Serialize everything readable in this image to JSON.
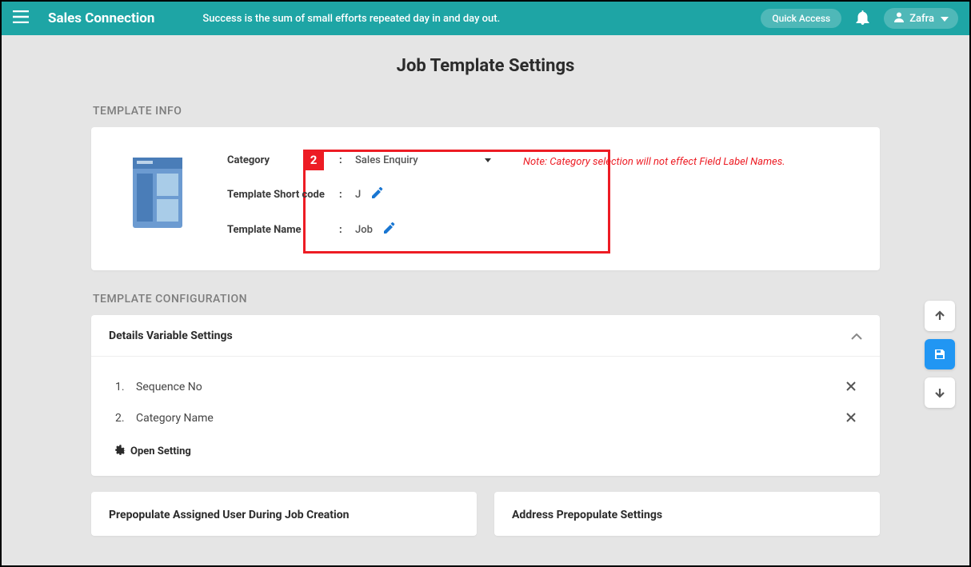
{
  "header": {
    "brand": "Sales Connection",
    "tagline": "Success is the sum of small efforts repeated day in and day out.",
    "quick_access": "Quick Access",
    "user_name": "Zafra"
  },
  "page_title": "Job Template Settings",
  "sections": {
    "template_info": "TEMPLATE INFO",
    "template_config": "TEMPLATE CONFIGURATION"
  },
  "annotation": {
    "badge": "2"
  },
  "template_info": {
    "category_label": "Category",
    "category_value": "Sales Enquiry",
    "shortcode_label": "Template Short code",
    "shortcode_value": "J",
    "name_label": "Template Name",
    "name_value": "Job",
    "note": "Note: Category selection will not effect Field Label Names."
  },
  "accordion": {
    "title": "Details Variable Settings",
    "items": [
      {
        "num": "1.",
        "label": "Sequence No"
      },
      {
        "num": "2.",
        "label": "Category Name"
      }
    ],
    "open_setting": "Open Setting"
  },
  "lower_cards": {
    "left": "Prepopulate Assigned User During Job Creation",
    "right": "Address Prepopulate Settings"
  }
}
